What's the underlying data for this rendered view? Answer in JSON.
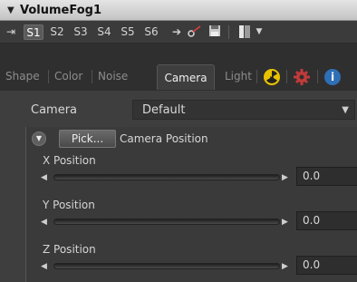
{
  "header": {
    "title": "VolumeFog1"
  },
  "toolbar": {
    "slots": [
      "S1",
      "S2",
      "S3",
      "S4",
      "S5",
      "S6"
    ],
    "selected_slot": "S1"
  },
  "tabs": {
    "items": [
      "Shape",
      "Color",
      "Noise",
      "Camera",
      "Light"
    ],
    "active": "Camera",
    "icons": [
      "radioactive-icon",
      "gear-icon",
      "info-icon"
    ]
  },
  "camera": {
    "label": "Camera",
    "dropdown_value": "Default"
  },
  "camera_position": {
    "pick_label": "Pick...",
    "title": "Camera Position",
    "sliders": [
      {
        "label": "X Position",
        "value": "0.0"
      },
      {
        "label": "Y Position",
        "value": "0.0"
      },
      {
        "label": "Z Position",
        "value": "0.0"
      }
    ]
  },
  "colors": {
    "panel_bg": "#3e3e3e",
    "header_bg": "#d6d6d6",
    "radioactive_yellow": "#e8c200",
    "gear_red": "#c23a3a",
    "info_blue": "#2f6fb6"
  }
}
